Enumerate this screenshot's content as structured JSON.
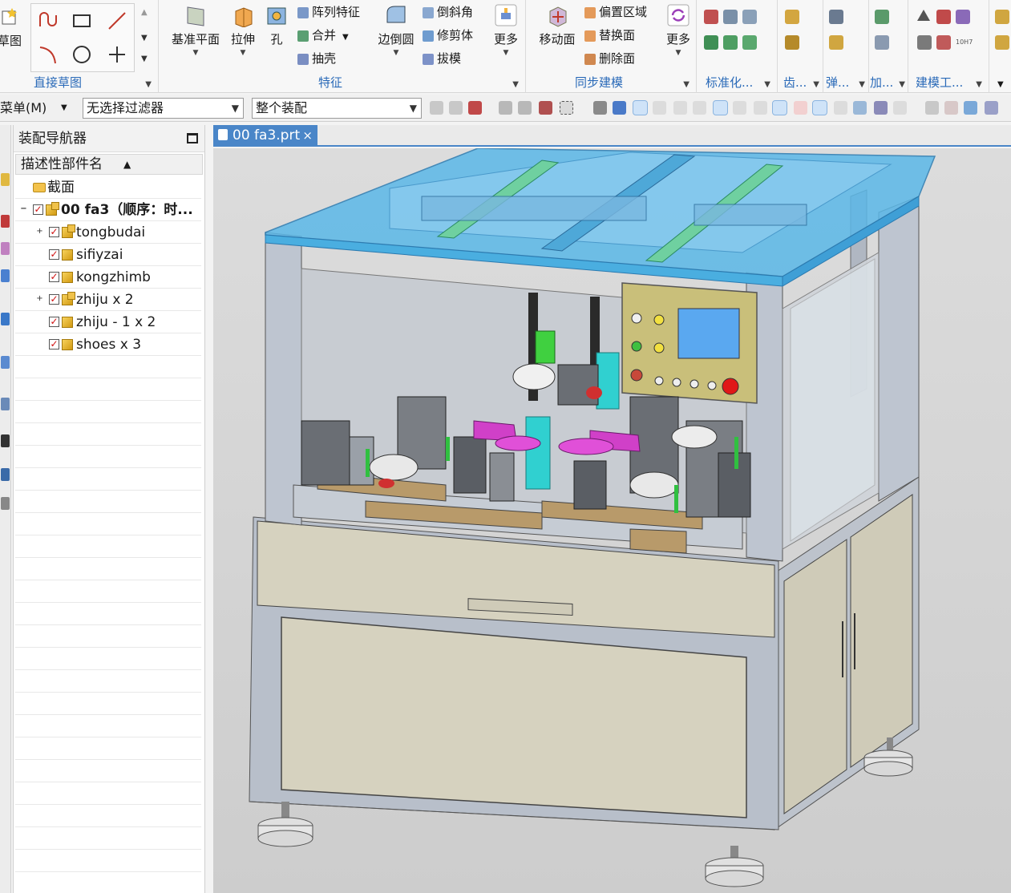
{
  "ribbon": {
    "groups": {
      "sketch": {
        "partial_label": "草图",
        "label": "直接草图"
      },
      "feature": {
        "label": "特征"
      },
      "sync": {
        "label": "同步建模"
      },
      "standard": {
        "label": "标准化..."
      },
      "gear": {
        "label": "齿..."
      },
      "spring": {
        "label": "弹..."
      },
      "machining": {
        "label": "加..."
      },
      "modeling_tools": {
        "label": "建模工..."
      }
    },
    "feature_buttons": {
      "datum_plane": "基准平面",
      "extrude": "拉伸",
      "hole": "孔",
      "pattern_feature": "阵列特征",
      "combine": "合并",
      "shell": "抽壳",
      "edge_blend": "边倒圆",
      "chamfer": "倒斜角",
      "trim_body": "修剪体",
      "draft": "拔模",
      "more": "更多"
    },
    "sync_buttons": {
      "move_face": "移动面",
      "offset_region": "偏置区域",
      "replace_face": "替换面",
      "delete_face": "删除面",
      "more": "更多"
    },
    "tiny_label": "10H7"
  },
  "toolbar": {
    "menu": "菜单(M)",
    "filter": "无选择过滤器",
    "scope": "整个装配"
  },
  "navigator": {
    "title": "装配导航器",
    "column_header": "描述性部件名",
    "rows": [
      {
        "name": "截面"
      },
      {
        "name": "00 fa3（顺序：时..."
      },
      {
        "name": "tongbudai"
      },
      {
        "name": "sifiyzai"
      },
      {
        "name": "kongzhimb"
      },
      {
        "name": "zhiju x 2"
      },
      {
        "name": "zhiju - 1 x 2"
      },
      {
        "name": "shoes x 3"
      }
    ]
  },
  "document": {
    "tab_title": "00 fa3.prt"
  },
  "colors": {
    "accent": "#4a86c8",
    "group_label": "#2a6ab8",
    "glass": "#5bb8e8",
    "frame": "#bcc4d3",
    "panel": "#d9d5c2",
    "control_panel": "#c9bf7a"
  }
}
